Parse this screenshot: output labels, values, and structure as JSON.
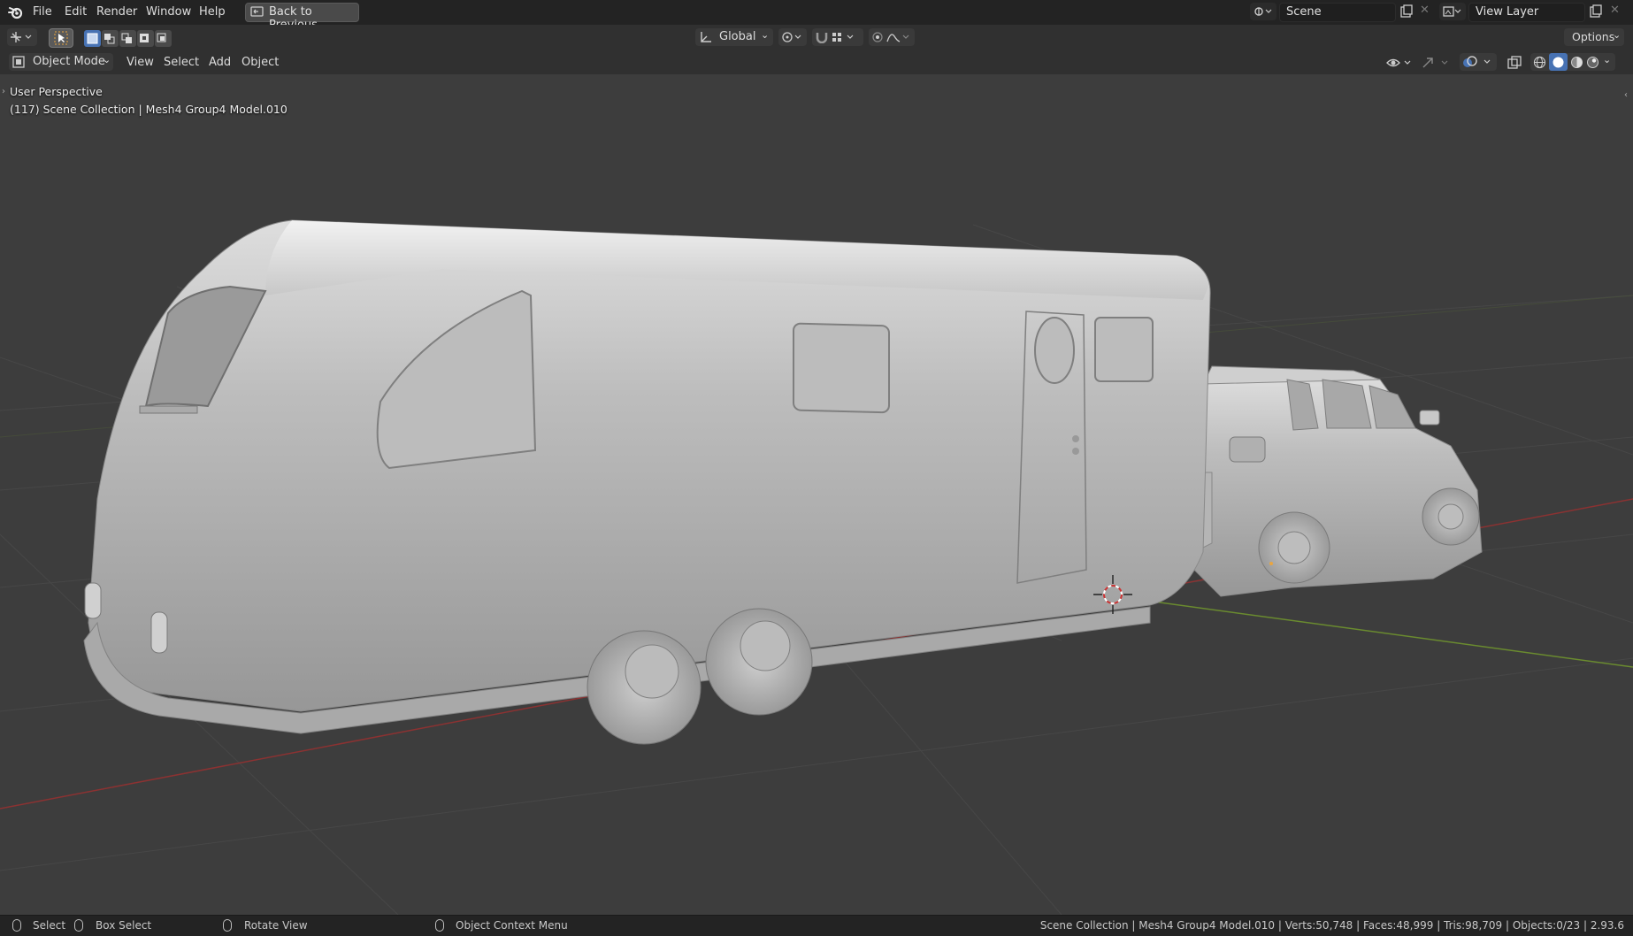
{
  "topbar": {
    "menus": [
      "File",
      "Edit",
      "Render",
      "Window",
      "Help"
    ],
    "back_button": "Back to Previous",
    "scene_name": "Scene",
    "view_layer": "View Layer"
  },
  "toolheader": {
    "transform_orientation": "Global",
    "options_label": "Options"
  },
  "viewheader": {
    "mode": "Object Mode",
    "menus": [
      "View",
      "Select",
      "Add",
      "Object"
    ]
  },
  "viewport": {
    "perspective_label": "User Perspective",
    "collection_label": "(117) Scene Collection | Mesh4 Group4 Model.010"
  },
  "statusbar": {
    "select": "Select",
    "box_select": "Box Select",
    "rotate_view": "Rotate View",
    "context_menu": "Object Context Menu",
    "stats": "Scene Collection | Mesh4 Group4 Model.010 | Verts:50,748 | Faces:48,999 | Tris:98,709 | Objects:0/23 | 2.93.6"
  },
  "icons": {
    "blender_logo": "blender-logo-icon",
    "editor_type": "3d-viewport-icon",
    "select_tool": "cursor-select-icon",
    "pivot": "pivot-icon",
    "snap": "magnet-snap-icon",
    "proportional": "proportional-edit-icon",
    "visibility": "eye-visibility-icon",
    "gizmo": "gizmo-icon",
    "overlay": "overlay-icon",
    "xray": "xray-icon",
    "shading": [
      "wireframe-shading-icon",
      "solid-shading-icon",
      "material-shading-icon",
      "rendered-shading-icon"
    ]
  },
  "colors": {
    "accent": "#4772b3",
    "x_axis": "#8b3232",
    "y_axis": "#6a8b2f",
    "viewport_bg": "#3d3d3d"
  }
}
